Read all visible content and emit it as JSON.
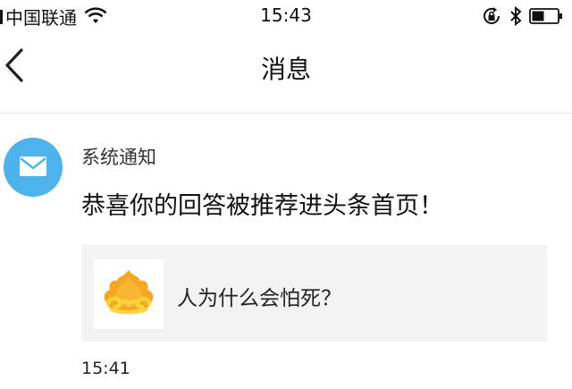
{
  "status_bar": {
    "carrier": "中国联通",
    "time": "15:43",
    "icons": [
      "signal-icon",
      "wifi-icon",
      "rotation-lock-icon",
      "bluetooth-icon",
      "battery-icon"
    ]
  },
  "nav": {
    "back_icon": "chevron-left-icon",
    "title": "消息"
  },
  "message": {
    "avatar_icon": "mail-icon",
    "sender": "系统通知",
    "text": "恭喜你的回答被推荐进头条首页！",
    "quote": {
      "thumb_icon": "logo-icon",
      "title": "人为什么会怕死？"
    },
    "time": "15:41"
  },
  "colors": {
    "avatar_bg": "#4db3ec",
    "card_bg": "#f3f3f3",
    "logo_orange": "#f5a623",
    "logo_yellow": "#ffd43b"
  }
}
